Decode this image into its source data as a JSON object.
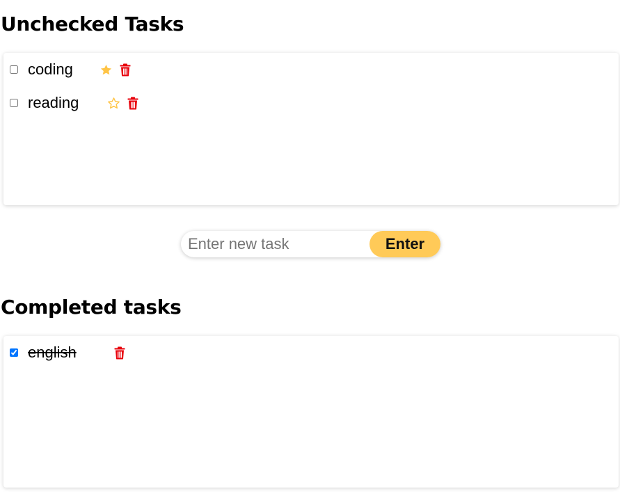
{
  "unchecked": {
    "title": "Unchecked Tasks",
    "tasks": [
      {
        "label": "coding",
        "checked": false,
        "starred": true
      },
      {
        "label": "reading",
        "checked": false,
        "starred": false
      }
    ]
  },
  "new_task": {
    "placeholder": "Enter new task",
    "value": "",
    "button_label": "Enter"
  },
  "completed": {
    "title": "Completed tasks",
    "tasks": [
      {
        "label": "english",
        "checked": true
      }
    ]
  },
  "colors": {
    "star": "#ffc445",
    "delete": "#e8000b",
    "button": "#ffca58",
    "checkbox_checked": "#1a73e8"
  },
  "icons": {
    "star_filled": "star-filled-icon",
    "star_outline": "star-outline-icon",
    "delete": "trash-icon"
  }
}
